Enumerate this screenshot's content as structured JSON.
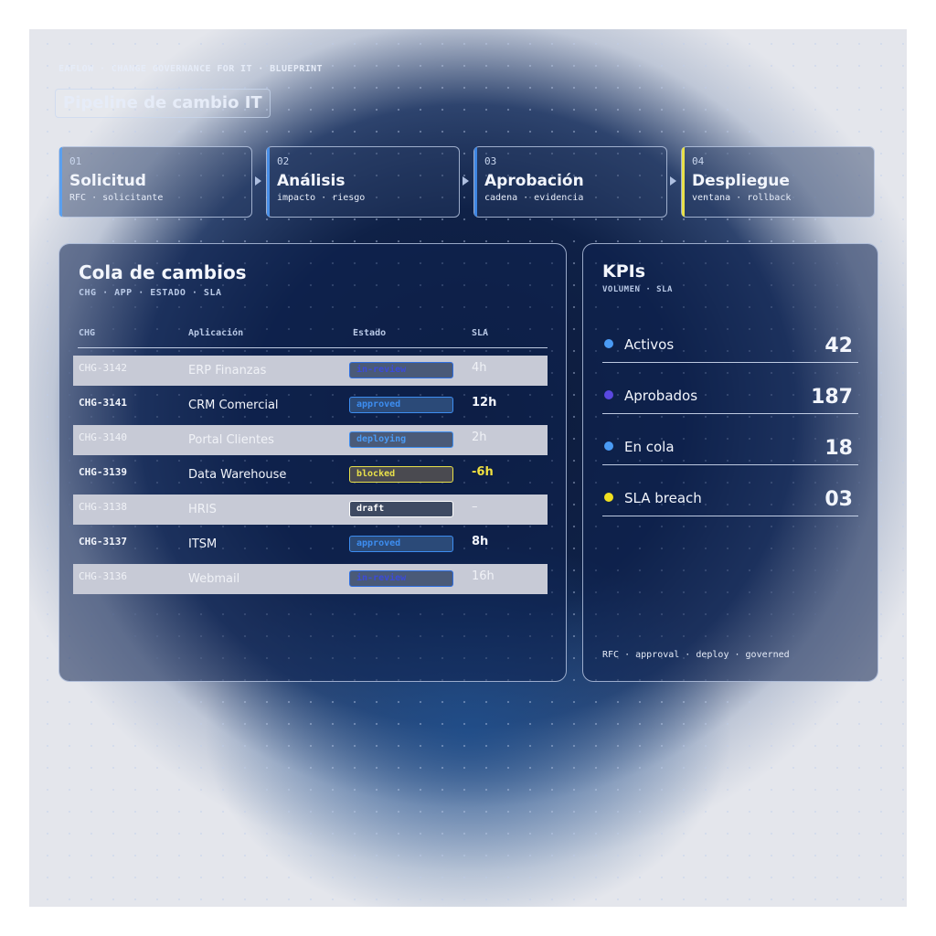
{
  "header": {
    "eyebrow": "EAFLOW · CHANGE GOVERNANCE FOR IT · BLUEPRINT",
    "title": "Pipeline de cambio IT"
  },
  "pipeline": [
    {
      "num": "01",
      "name": "Solicitud",
      "sub": "RFC · solicitante",
      "color": "#5aa0f0"
    },
    {
      "num": "02",
      "name": "Análisis",
      "sub": "impacto · riesgo",
      "color": "#4a90e8"
    },
    {
      "num": "03",
      "name": "Aprobación",
      "sub": "cadena · evidencia",
      "color": "#3f86e2"
    },
    {
      "num": "04",
      "name": "Despliegue",
      "sub": "ventana · rollback",
      "color": "#e8e04a"
    }
  ],
  "queue": {
    "title": "Cola de cambios",
    "subtitle": "CHG · APP · ESTADO · SLA",
    "columns": {
      "chg": "CHG",
      "app": "Aplicación",
      "status": "Estado",
      "sla": "SLA"
    },
    "rows": [
      {
        "chg": "CHG-3142",
        "app": "ERP Finanzas",
        "status": "in-review",
        "sla": "4h",
        "shaded": true,
        "badge_color": "#3b4bd8",
        "badge_border": "#2f6fe0",
        "badge_bg": "#4a5a78",
        "sla_color": ""
      },
      {
        "chg": "CHG-3141",
        "app": "CRM Comercial",
        "status": "approved",
        "sla": "12h",
        "shaded": false,
        "badge_color": "#3d8df0",
        "badge_border": "#3d8df0",
        "badge_bg": "#2b4a78",
        "sla_color": ""
      },
      {
        "chg": "CHG-3140",
        "app": "Portal Clientes",
        "status": "deploying",
        "sla": "2h",
        "shaded": true,
        "badge_color": "#4a9bf5",
        "badge_border": "#3d8df0",
        "badge_bg": "#4a5a78",
        "sla_color": ""
      },
      {
        "chg": "CHG-3139",
        "app": "Data Warehouse",
        "status": "blocked",
        "sla": "-6h",
        "shaded": false,
        "badge_color": "#e8e04a",
        "badge_border": "#e8e04a",
        "badge_bg": "#4a4a50",
        "sla_color": "#f0e040"
      },
      {
        "chg": "CHG-3138",
        "app": "HRIS",
        "status": "draft",
        "sla": "–",
        "shaded": true,
        "badge_color": "#ffffff",
        "badge_border": "#ffffff",
        "badge_bg": "#3e4a62",
        "sla_color": ""
      },
      {
        "chg": "CHG-3137",
        "app": "ITSM",
        "status": "approved",
        "sla": "8h",
        "shaded": false,
        "badge_color": "#3d8df0",
        "badge_border": "#3d8df0",
        "badge_bg": "#2b4a78",
        "sla_color": ""
      },
      {
        "chg": "CHG-3136",
        "app": "Webmail",
        "status": "in-review",
        "sla": "16h",
        "shaded": true,
        "badge_color": "#3b4bd8",
        "badge_border": "#2f6fe0",
        "badge_bg": "#4a5a78",
        "sla_color": ""
      }
    ]
  },
  "kpis": {
    "title": "KPIs",
    "subtitle": "VOLUMEN · SLA",
    "items": [
      {
        "label": "Activos",
        "value": "42",
        "color": "#4a9bf5"
      },
      {
        "label": "Aprobados",
        "value": "187",
        "color": "#5a48e0"
      },
      {
        "label": "En cola",
        "value": "18",
        "color": "#4a9bf5"
      },
      {
        "label": "SLA breach",
        "value": "03",
        "color": "#f0e020"
      }
    ],
    "footer": "RFC · approval · deploy · governed"
  }
}
